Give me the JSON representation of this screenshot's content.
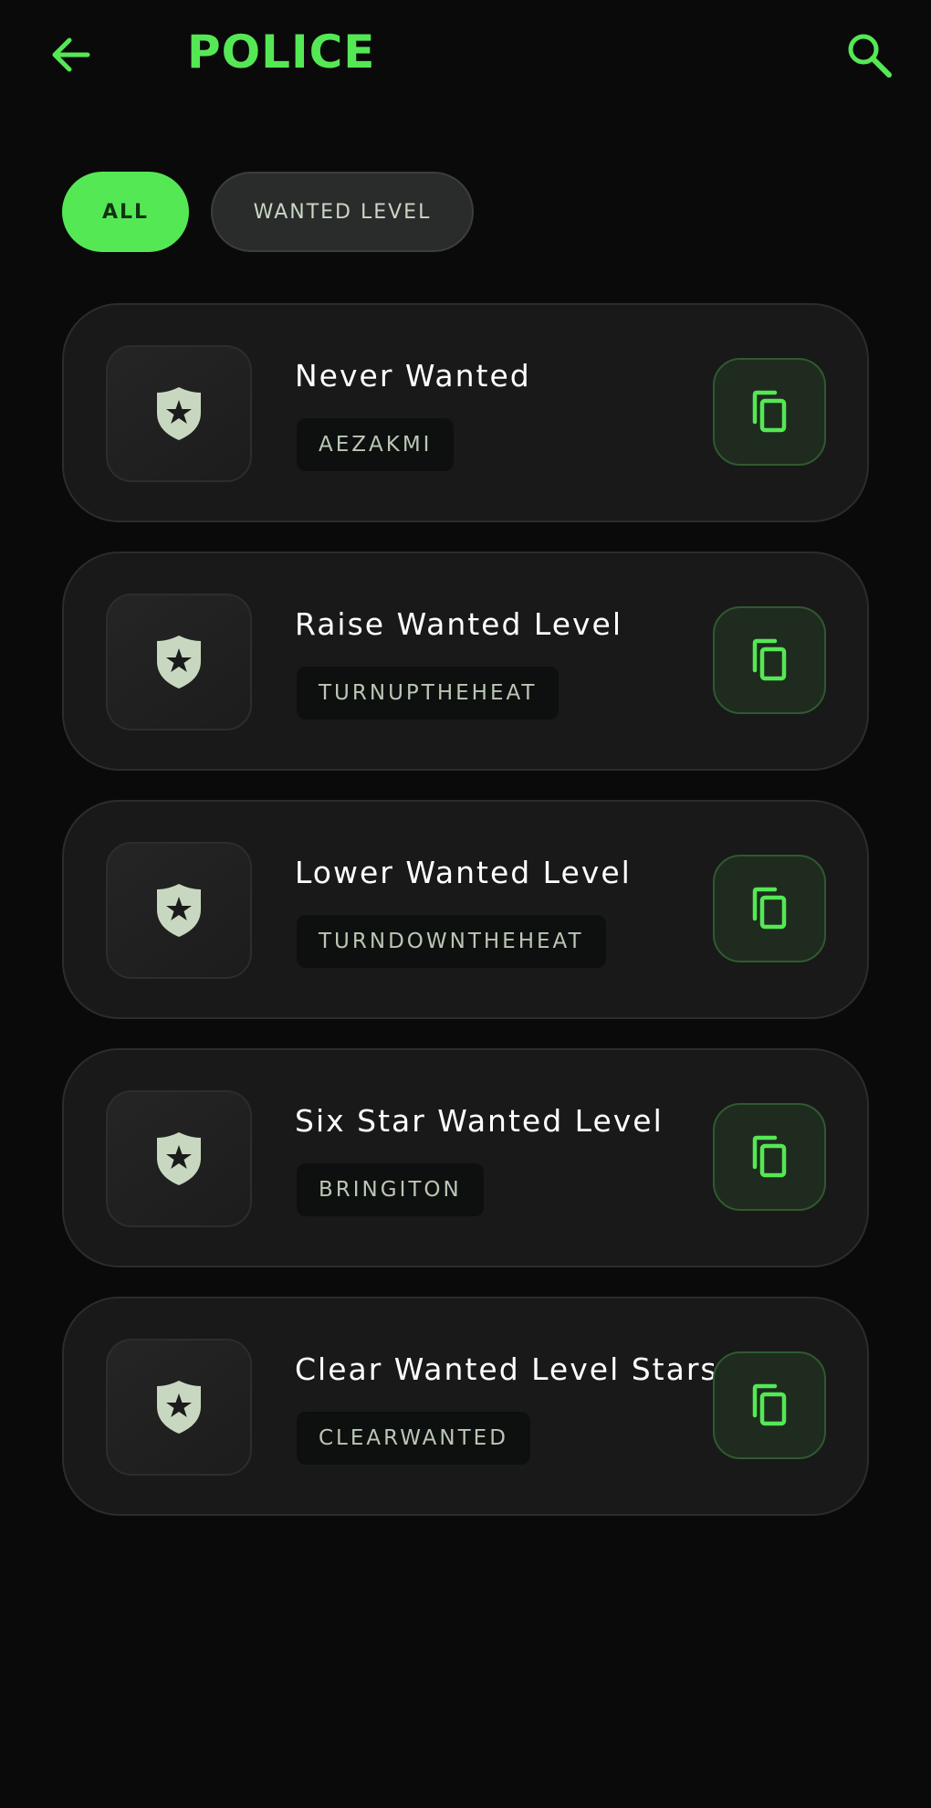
{
  "header": {
    "title": "POLICE",
    "back_icon": "arrow-left-icon",
    "search_icon": "search-icon"
  },
  "filters": [
    {
      "label": "ALL",
      "selected": true
    },
    {
      "label": "WANTED LEVEL",
      "selected": false
    }
  ],
  "cheats": [
    {
      "name": "Never Wanted",
      "code": "AEZAKMI",
      "icon": "police-shield-star-icon",
      "action_icon": "copy-icon"
    },
    {
      "name": "Raise Wanted Level",
      "code": "TURNUPTHEHEAT",
      "icon": "police-shield-star-icon",
      "action_icon": "copy-icon"
    },
    {
      "name": "Lower Wanted Level",
      "code": "TURNDOWNTHEHEAT",
      "icon": "police-shield-star-icon",
      "action_icon": "copy-icon"
    },
    {
      "name": "Six Star Wanted Level",
      "code": "BRINGITON",
      "icon": "police-shield-star-icon",
      "action_icon": "copy-icon"
    },
    {
      "name": "Clear Wanted Level Stars",
      "code": "CLEARWANTED",
      "icon": "police-shield-star-icon",
      "action_icon": "copy-icon"
    }
  ],
  "colors": {
    "background": "#0a0a0a",
    "accent": "#55e855",
    "card_background": "#191919",
    "chip_inactive_background": "#2a2b2b",
    "chip_inactive_text": "#c9d6c4",
    "title_text": "#ffffff",
    "code_text": "#b9c7b4",
    "shield": "#c8d8c0",
    "copy_button_background": "#1f2b1f",
    "copy_button_border": "#2f5a2f"
  }
}
